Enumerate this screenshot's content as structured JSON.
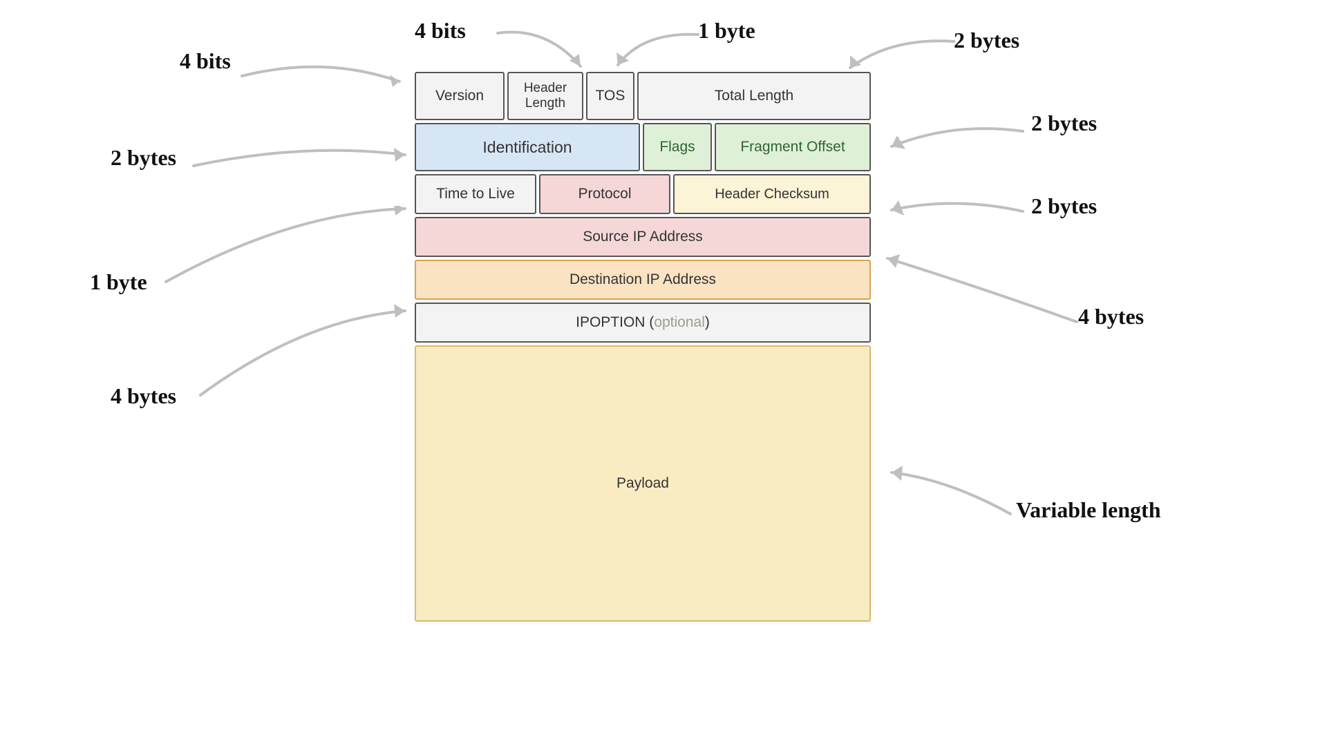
{
  "fields": {
    "version": "Version",
    "header_length": "Header\nLength",
    "tos": "TOS",
    "total_length": "Total Length",
    "identification": "Identification",
    "flags": "Flags",
    "fragment_offset": "Fragment Offset",
    "ttl": "Time to Live",
    "protocol": "Protocol",
    "checksum": "Header Checksum",
    "src_ip": "Source IP Address",
    "dst_ip": "Destination IP Address",
    "ipoption_prefix": "IPOPTION (",
    "ipoption_optional": "optional",
    "ipoption_suffix": ")",
    "payload": "Payload"
  },
  "annotations": {
    "version_size": "4 bits",
    "header_length_size": "4 bits",
    "tos_size": "1 byte",
    "total_length_size": "2 bytes",
    "identification_size": "2 bytes",
    "flags_frag_size": "2 bytes",
    "ttl_size": "1 byte",
    "checksum_size": "2 bytes",
    "src_ip_size": "4 bytes",
    "dst_ip_size": "4 bytes",
    "payload_size": "Variable length"
  }
}
